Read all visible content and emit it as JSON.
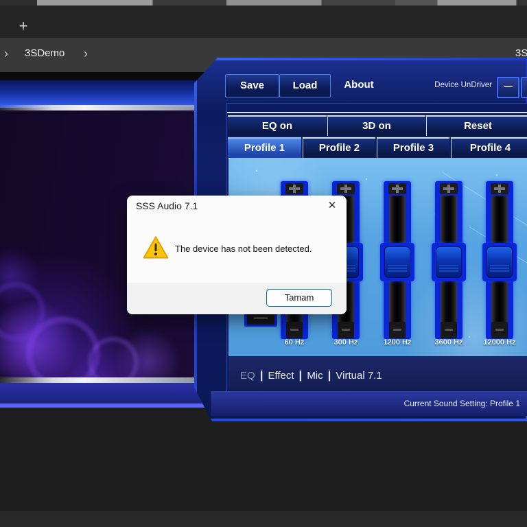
{
  "browser": {
    "new_tab_icon": "+",
    "breadcrumb": {
      "chevron": "›",
      "item": "3SDemo",
      "clipped_right_text": "3S"
    }
  },
  "app": {
    "header": {
      "save_label": "Save",
      "load_label": "Load",
      "about_label": "About",
      "device_status": "Device UnDriver",
      "minimize_glyph": "—"
    },
    "toolbar": {
      "eq_toggle": "EQ on",
      "threed_toggle": "3D on",
      "reset": "Reset"
    },
    "profiles": {
      "items": [
        "Profile 1",
        "Profile 2",
        "Profile 3",
        "Profile 4"
      ],
      "active": "Profile 1"
    },
    "eq": {
      "bands": [
        {
          "label": "60 Hz",
          "value_percent": 50
        },
        {
          "label": "300 Hz",
          "value_percent": 50
        },
        {
          "label": "1200 Hz",
          "value_percent": 50
        },
        {
          "label": "3600 Hz",
          "value_percent": 50
        },
        {
          "label": "12000 Hz",
          "value_percent": 50
        }
      ]
    },
    "menu": {
      "items": [
        "EQ",
        "Effect",
        "Mic",
        "Virtual 7.1"
      ],
      "separator": "|",
      "current": "EQ"
    },
    "status": {
      "text": "Current Sound Setting: Profile 1"
    }
  },
  "dialog": {
    "title": "SSS Audio 7.1",
    "close_glyph": "✕",
    "message": "The device has not been detected.",
    "ok_label": "Tamam"
  },
  "colors": {
    "window_frame_blue": "#2448d8",
    "eq_panel_blue": "#58a5e2",
    "slider_blue": "#0a26d6",
    "dialog_accent": "#0067c0",
    "bokeh_purple": "#8040f0"
  }
}
